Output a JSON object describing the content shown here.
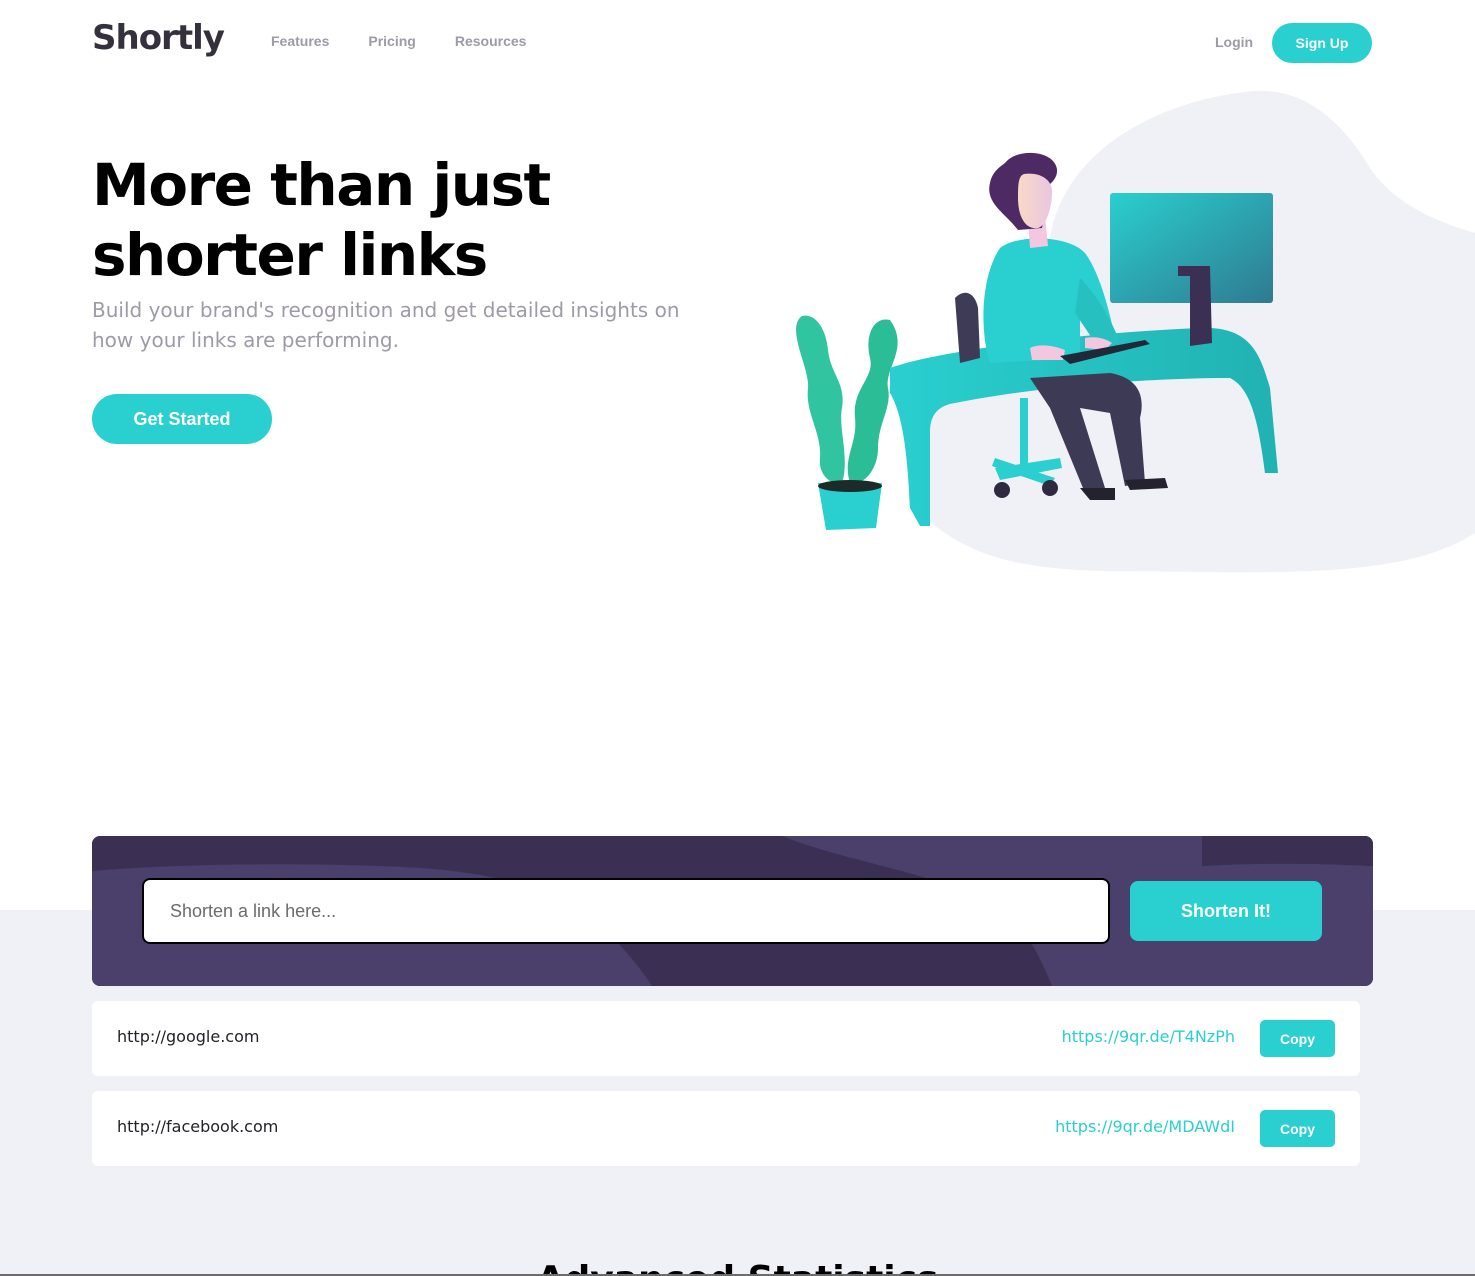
{
  "header": {
    "logo": "Shortly",
    "nav": [
      "Features",
      "Pricing",
      "Resources"
    ],
    "login": "Login",
    "signup": "Sign Up"
  },
  "hero": {
    "title_line1": "More than just",
    "title_line2": "shorter links",
    "subtitle": "Build your brand's recognition and get detailed insights on how your links are performing.",
    "cta": "Get Started",
    "illustration": "person-working-at-desk-illustration"
  },
  "shorten": {
    "placeholder": "Shorten a link here...",
    "button": "Shorten It!"
  },
  "results": [
    {
      "original": "http://google.com",
      "short": "https://9qr.de/T4NzPh",
      "copy": "Copy"
    },
    {
      "original": "http://facebook.com",
      "short": "https://9qr.de/MDAWdI",
      "copy": "Copy"
    }
  ],
  "next_section": {
    "heading": "Advanced Statistics"
  },
  "colors": {
    "cyan": "#2acfcf",
    "dark_violet": "#3b3054",
    "gray_violet": "#9e9aa7",
    "light_gray": "#f0f1f6"
  }
}
